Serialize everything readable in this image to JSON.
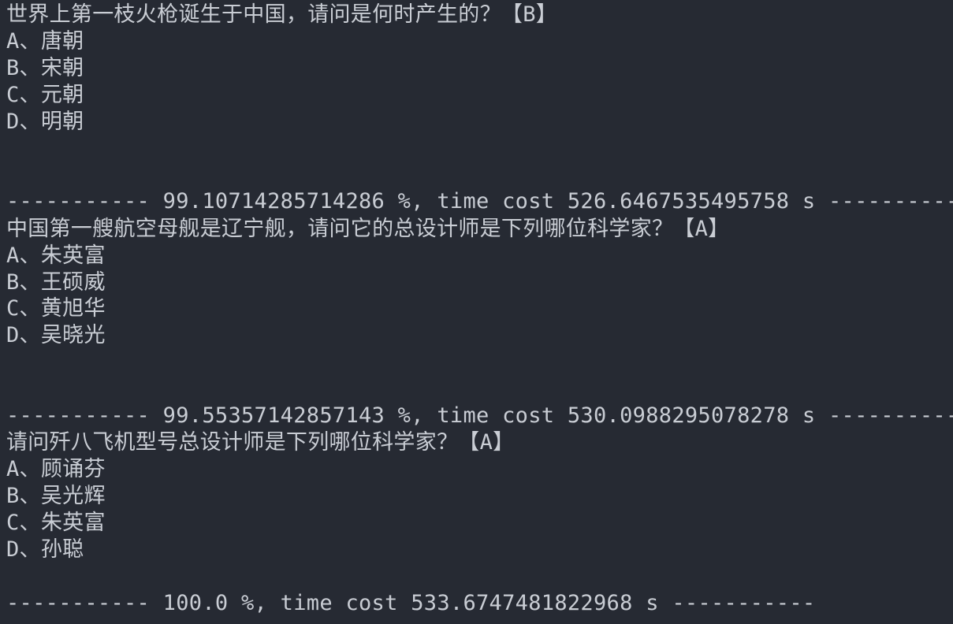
{
  "terminal": {
    "lines": [
      "世界上第一枝火枪诞生于中国，请问是何时产生的？【B】",
      "A、唐朝",
      "B、宋朝",
      "C、元朝",
      "D、明朝",
      "",
      "",
      "----------- 99.10714285714286 %, time cost 526.6467535495758 s -----------",
      "中国第一艘航空母舰是辽宁舰，请问它的总设计师是下列哪位科学家？【A】",
      "A、朱英富",
      "B、王硕威",
      "C、黄旭华",
      "D、吴晓光",
      "",
      "",
      "----------- 99.55357142857143 %, time cost 530.0988295078278 s -----------",
      "请问歼八飞机型号总设计师是下列哪位科学家？【A】",
      "A、顾诵芬",
      "B、吴光辉",
      "C、朱英富",
      "D、孙聪",
      "",
      "----------- 100.0 %, time cost 533.6747481822968 s -----------"
    ]
  }
}
